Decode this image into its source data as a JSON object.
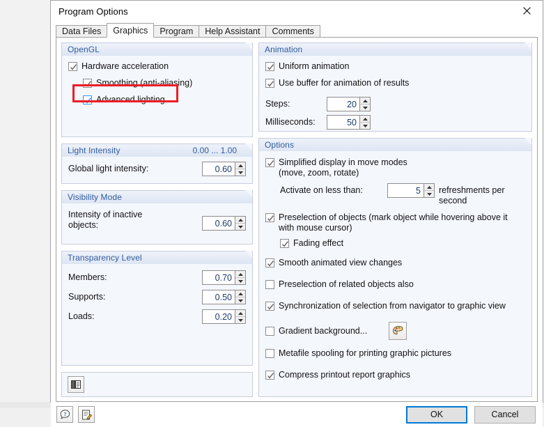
{
  "window": {
    "title": "Program Options",
    "close_icon": "close-icon"
  },
  "tabs": [
    {
      "label": "Data Files",
      "active": false
    },
    {
      "label": "Graphics",
      "active": true
    },
    {
      "label": "Program",
      "active": false
    },
    {
      "label": "Help Assistant",
      "active": false
    },
    {
      "label": "Comments",
      "active": false
    }
  ],
  "colors": {
    "group_header_text": "#2f5b9e",
    "highlight_red": "#ee1c25",
    "default_button_border": "#0078d7",
    "spin_value_text": "#1b3a6b",
    "checkbox_focus_border": "#3399ff"
  },
  "left": {
    "opengl": {
      "title": "OpenGL",
      "items": [
        {
          "label": "Hardware acceleration",
          "checked": true,
          "indent": 0,
          "focused": false
        },
        {
          "label": "Smoothing (anti-aliasing)",
          "checked": true,
          "indent": 1,
          "focused": false
        },
        {
          "label": "Advanced lighting",
          "checked": true,
          "indent": 1,
          "focused": true
        }
      ],
      "highlighted_item": "Advanced lighting"
    },
    "light_intensity": {
      "title": "Light Intensity",
      "range_note": "0.00 ... 1.00",
      "fields": [
        {
          "label": "Global light intensity:",
          "value": "0.60"
        }
      ]
    },
    "visibility_mode": {
      "title": "Visibility Mode",
      "fields": [
        {
          "label": "Intensity of inactive objects:",
          "value": "0.60"
        }
      ]
    },
    "transparency_level": {
      "title": "Transparency Level",
      "fields": [
        {
          "label": "Members:",
          "value": "0.70"
        },
        {
          "label": "Supports:",
          "value": "0.50"
        },
        {
          "label": "Loads:",
          "value": "0.20"
        }
      ]
    },
    "bottom_tool": {
      "icon": "list-details-icon"
    }
  },
  "right": {
    "animation": {
      "title": "Animation",
      "items": [
        {
          "label": "Uniform animation",
          "checked": true
        },
        {
          "label": "Use buffer for animation of results",
          "checked": true
        }
      ],
      "fields": [
        {
          "label": "Steps:",
          "value": "20"
        },
        {
          "label": "Milliseconds:",
          "value": "50"
        }
      ]
    },
    "options": {
      "title": "Options",
      "simplified": {
        "label_line1": "Simplified display in move modes",
        "label_line2": "(move, zoom, rotate)",
        "checked": true,
        "sub_label": "Activate on less than:",
        "sub_value": "5",
        "sub_suffix_line1": "refreshments per",
        "sub_suffix_line2": "second"
      },
      "preselection": {
        "label_line1": "Preselection of objects (mark object while hovering above it",
        "label_line2": "with mouse cursor)",
        "checked": true,
        "sub_label": "Fading effect",
        "sub_checked": true
      },
      "items": [
        {
          "label": "Smooth animated view changes",
          "checked": true,
          "has_color_button": false
        },
        {
          "label": "Preselection of related objects also",
          "checked": false,
          "has_color_button": false
        },
        {
          "label": "Synchronization of selection from navigator to graphic view",
          "checked": true,
          "has_color_button": false
        },
        {
          "label": "Gradient background...",
          "checked": false,
          "has_color_button": true,
          "color_button_icon": "color-palette-icon"
        },
        {
          "label": "Metafile spooling for printing graphic pictures",
          "checked": false,
          "has_color_button": false
        },
        {
          "label": "Compress printout report graphics",
          "checked": true,
          "has_color_button": false
        }
      ]
    }
  },
  "footer": {
    "help_icon": "help-question-icon",
    "notes_icon": "edit-note-icon",
    "ok_label": "OK",
    "cancel_label": "Cancel"
  }
}
